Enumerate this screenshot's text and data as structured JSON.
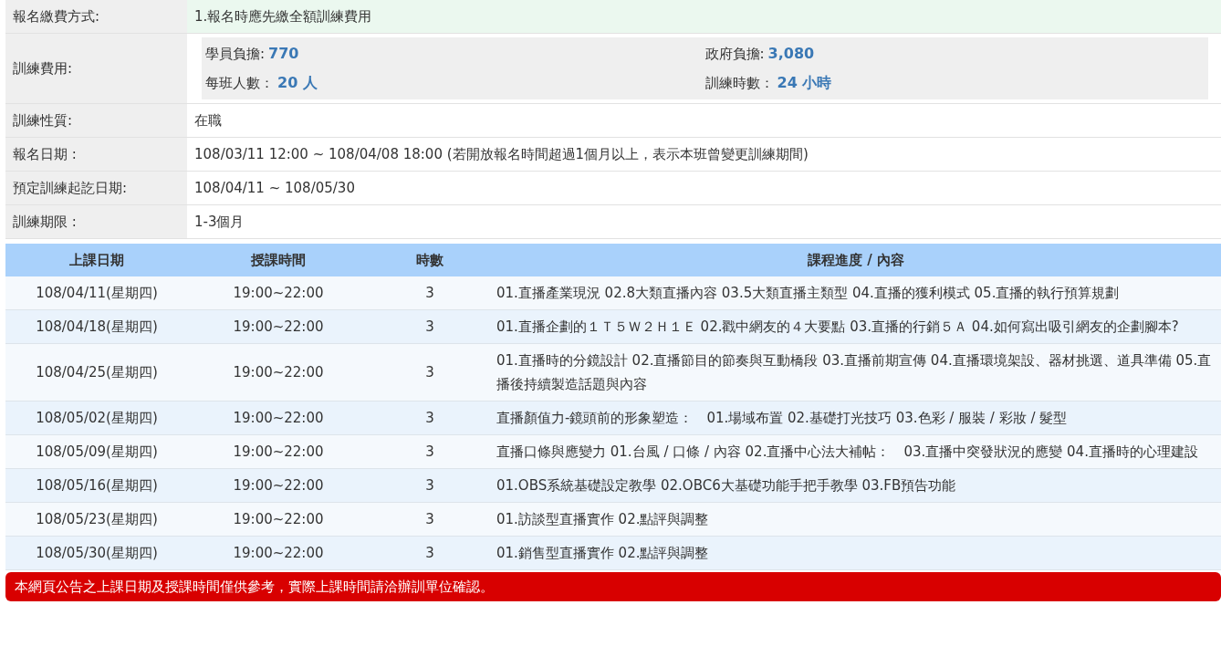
{
  "info_rows": [
    {
      "label": "報名繳費方式:",
      "kind": "text",
      "highlighted": true,
      "value": "1.報名時應先繳全額訓練費用"
    },
    {
      "label": "訓練費用:",
      "kind": "fees",
      "highlighted": false,
      "fees": [
        {
          "label": "學員負擔:",
          "value": "770"
        },
        {
          "label": "政府負擔:",
          "value": "3,080"
        },
        {
          "label": "每班人數：",
          "value": "20 人"
        },
        {
          "label": "訓練時數：",
          "value": "24 小時"
        }
      ]
    },
    {
      "label": "訓練性質:",
      "kind": "text",
      "highlighted": false,
      "value": "在職"
    },
    {
      "label": "報名日期 :",
      "kind": "text",
      "highlighted": false,
      "value": "108/03/11 12:00 ~ 108/04/08 18:00 (若開放報名時間超過1個月以上，表示本班曾變更訓練期間)"
    },
    {
      "label": "預定訓練起訖日期:",
      "kind": "text",
      "highlighted": false,
      "value": "108/04/11 ~ 108/05/30"
    },
    {
      "label": "訓練期限 :",
      "kind": "text",
      "highlighted": false,
      "value": "1-3個月"
    }
  ],
  "schedule": {
    "columns": [
      "上課日期",
      "授課時間",
      "時數",
      "課程進度 / 內容"
    ],
    "rows": [
      [
        "108/04/11(星期四)",
        "19:00~22:00",
        "3",
        "01.直播產業現況 02.8大類直播內容 03.5大類直播主類型 04.直播的獲利模式 05.直播的執行預算規劃"
      ],
      [
        "108/04/18(星期四)",
        "19:00~22:00",
        "3",
        "01.直播企劃的１Ｔ５Ｗ２Ｈ１Ｅ 02.戳中網友的４大要點 03.直播的行銷５Ａ 04.如何寫出吸引網友的企劃腳本?"
      ],
      [
        "108/04/25(星期四)",
        "19:00~22:00",
        "3",
        "01.直播時的分鏡設計 02.直播節目的節奏與互動橋段 03.直播前期宣傳 04.直播環境架設、器材挑選、道具準備 05.直播後持續製造話題與內容"
      ],
      [
        "108/05/02(星期四)",
        "19:00~22:00",
        "3",
        "直播顏值力-鏡頭前的形象塑造：　01.場域布置 02.基礎打光技巧 03.色彩 / 服裝 / 彩妝 / 髮型"
      ],
      [
        "108/05/09(星期四)",
        "19:00~22:00",
        "3",
        "直播口條與應變力 01.台風 / 口條 / 內容 02.直播中心法大補帖：　03.直播中突發狀況的應變 04.直播時的心理建設"
      ],
      [
        "108/05/16(星期四)",
        "19:00~22:00",
        "3",
        "01.OBS系統基礎設定教學 02.OBC6大基礎功能手把手教學 03.FB預告功能"
      ],
      [
        "108/05/23(星期四)",
        "19:00~22:00",
        "3",
        "01.訪談型直播實作 02.點評與調整"
      ],
      [
        "108/05/30(星期四)",
        "19:00~22:00",
        "3",
        "01.銷售型直播實作 02.點評與調整"
      ]
    ]
  },
  "notice": "本網頁公告之上課日期及授課時間僅供參考，實際上課時間請洽辦訓單位確認。"
}
